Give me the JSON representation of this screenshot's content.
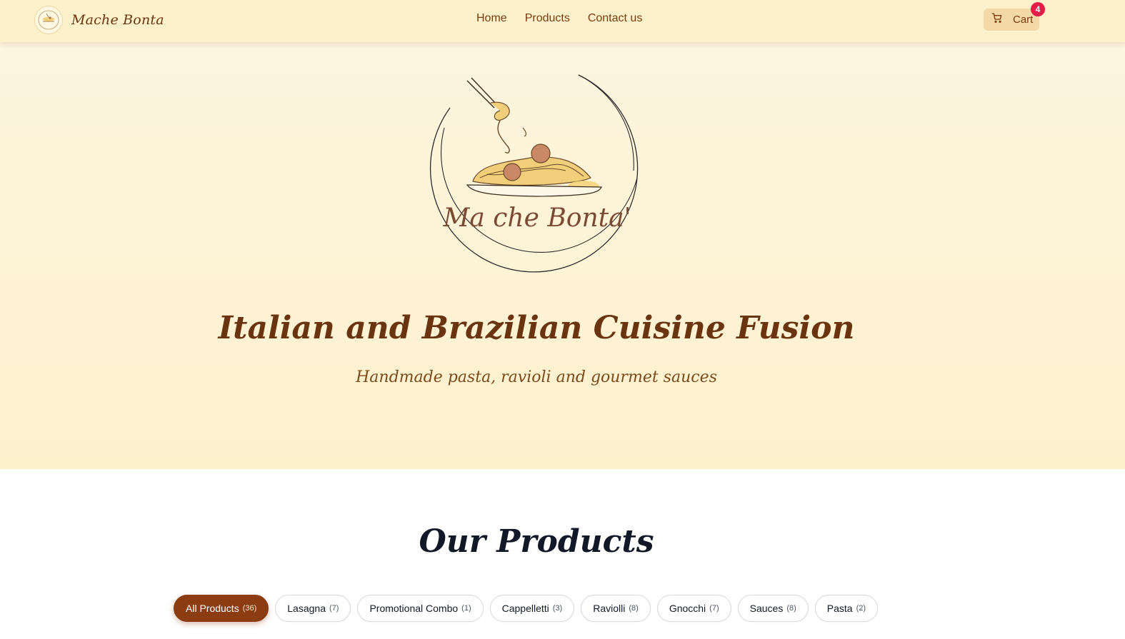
{
  "header": {
    "brand_name": "Mache Bonta",
    "logo_text": "Ma che Bonta",
    "nav": [
      {
        "label": "Home"
      },
      {
        "label": "Products"
      },
      {
        "label": "Contact us"
      }
    ],
    "cart": {
      "label": "Cart",
      "count": "4"
    }
  },
  "hero": {
    "logo_text": "Ma che Bonta'",
    "title": "Italian and Brazilian Cuisine Fusion",
    "subtitle": "Handmade pasta, ravioli and gourmet sauces"
  },
  "products": {
    "title": "Our Products",
    "filters": [
      {
        "label": "All Products",
        "count": "(36)"
      },
      {
        "label": "Lasagna",
        "count": "(7)"
      },
      {
        "label": "Promotional Combo",
        "count": "(1)"
      },
      {
        "label": "Cappelletti",
        "count": "(3)"
      },
      {
        "label": "Raviolli",
        "count": "(8)"
      },
      {
        "label": "Gnocchi",
        "count": "(7)"
      },
      {
        "label": "Sauces",
        "count": "(8)"
      },
      {
        "label": "Pasta",
        "count": "(2)"
      }
    ]
  },
  "colors": {
    "header_bg": "#fdf1cc",
    "brand_brown": "#8b3c10",
    "badge_red": "#e11d48",
    "cart_bg": "#f3d9a7"
  }
}
